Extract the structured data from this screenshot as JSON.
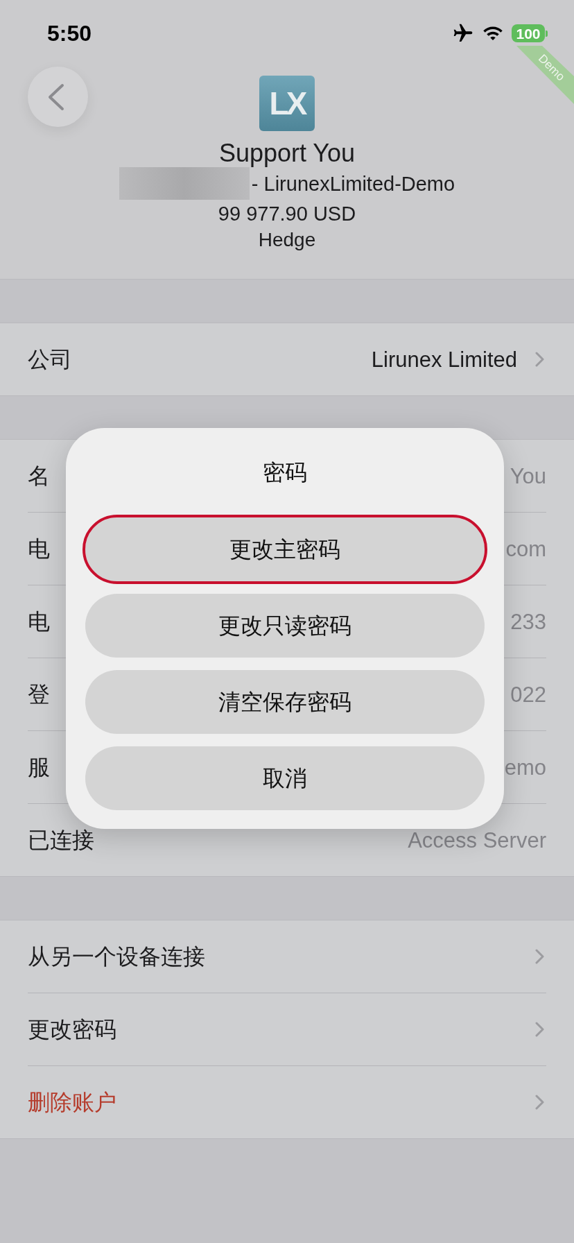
{
  "status_bar": {
    "time": "5:50",
    "battery": "100"
  },
  "ribbon": {
    "label": "Demo"
  },
  "header": {
    "logo": "LX",
    "name": "Support You",
    "server": "- LirunexLimited-Demo",
    "balance": "99 977.90 USD",
    "account_type": "Hedge"
  },
  "sections": [
    {
      "rows": [
        {
          "kind": "link",
          "label": "公司",
          "value": "Lirunex Limited"
        }
      ]
    },
    {
      "rows": [
        {
          "kind": "info",
          "label": "名",
          "value": "You"
        },
        {
          "kind": "info",
          "label": "电",
          "value": "com"
        },
        {
          "kind": "info",
          "label": "电",
          "value": "233"
        },
        {
          "kind": "info",
          "label": "登",
          "value": "022"
        },
        {
          "kind": "info",
          "label": "服",
          "value": "emo"
        },
        {
          "kind": "info",
          "label": "已连接",
          "value": "Access Server"
        }
      ]
    },
    {
      "rows": [
        {
          "kind": "action",
          "label": "从另一个设备连接"
        },
        {
          "kind": "action",
          "label": "更改密码"
        },
        {
          "kind": "destructive",
          "label": "删除账户"
        }
      ]
    }
  ],
  "dialog": {
    "title": "密码",
    "buttons": [
      {
        "label": "更改主密码",
        "highlighted": true
      },
      {
        "label": "更改只读密码",
        "highlighted": false
      },
      {
        "label": "清空保存密码",
        "highlighted": false
      },
      {
        "label": "取消",
        "highlighted": false
      }
    ]
  }
}
